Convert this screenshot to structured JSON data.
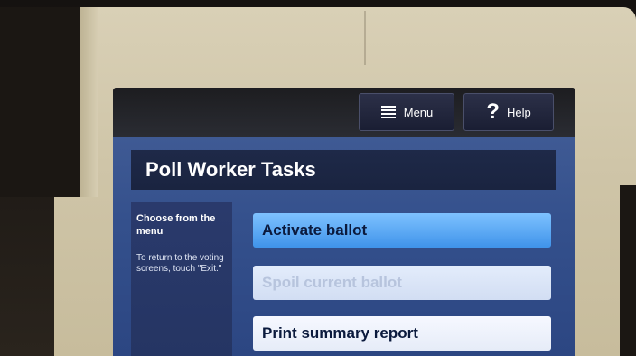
{
  "topbar": {
    "menu_label": "Menu",
    "menu_icon": "hamburger-menu-icon",
    "help_label": "Help",
    "help_icon": "question-mark-icon"
  },
  "page": {
    "title": "Poll Worker Tasks"
  },
  "sidebar": {
    "heading": "Choose from the menu",
    "instructions": "To return to the voting screens, touch \"Exit.\""
  },
  "tasks": [
    {
      "label": "Activate ballot",
      "state": "active"
    },
    {
      "label": "Spoil current ballot",
      "state": "disabled"
    },
    {
      "label": "Print summary report",
      "state": "enabled"
    }
  ],
  "colors": {
    "accent": "#3f93ea",
    "screen_background": "#34508c",
    "title_bar": "#1e2948",
    "bezel": "#d2c8ab"
  }
}
